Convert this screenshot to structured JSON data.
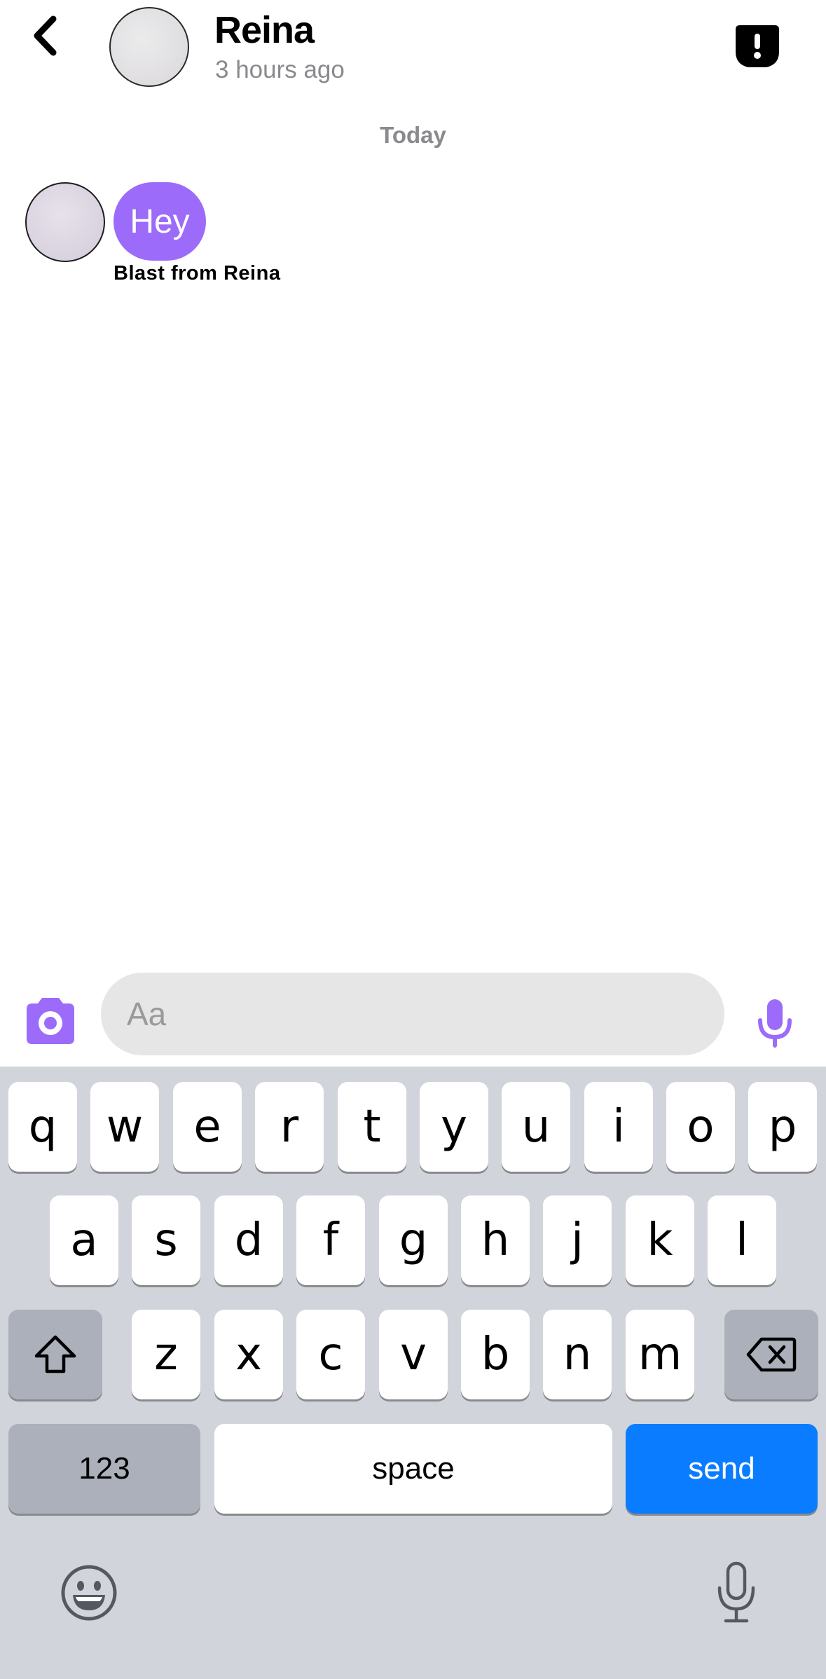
{
  "header": {
    "back_icon": "chevron-left-icon",
    "contact_name": "Reina",
    "last_seen": "3 hours ago",
    "report_icon": "alert-shield-icon"
  },
  "chat": {
    "day_label": "Today",
    "messages": [
      {
        "text": "Hey",
        "caption": "Blast from Reina",
        "bubble_color": "#9c6bfa"
      }
    ]
  },
  "composer": {
    "camera_icon": "camera-icon",
    "input_placeholder": "Aa",
    "input_value": "",
    "mic_icon": "microphone-icon",
    "accent_color": "#9c6bfa"
  },
  "keyboard": {
    "row1": [
      "q",
      "w",
      "e",
      "r",
      "t",
      "y",
      "u",
      "i",
      "o",
      "p"
    ],
    "row2": [
      "a",
      "s",
      "d",
      "f",
      "g",
      "h",
      "j",
      "k",
      "l"
    ],
    "row3": [
      "z",
      "x",
      "c",
      "v",
      "b",
      "n",
      "m"
    ],
    "numbers_label": "123",
    "space_label": "space",
    "send_label": "send",
    "send_color": "#0a7cff",
    "shift_icon": "shift-arrow-icon",
    "delete_icon": "backspace-icon",
    "emoji_icon": "emoji-icon",
    "dictation_icon": "dictation-mic-icon"
  }
}
